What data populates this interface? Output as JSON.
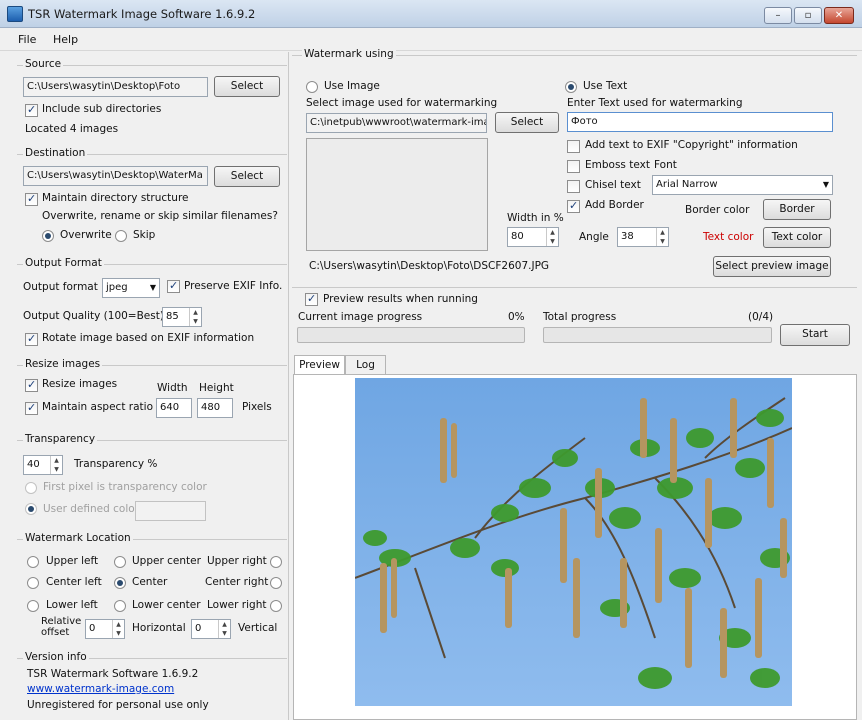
{
  "window": {
    "title": "TSR Watermark Image Software 1.6.9.2",
    "min": "–",
    "max": "▫",
    "close": "✕"
  },
  "menu": {
    "file": "File",
    "help": "Help"
  },
  "source": {
    "title": "Source",
    "path": "C:\\Users\\wasytin\\Desktop\\Foto",
    "select": "Select",
    "include_sub": "Include sub directories",
    "located": "Located 4 images"
  },
  "destination": {
    "title": "Destination",
    "path": "C:\\Users\\wasytin\\Desktop\\WaterMa",
    "select": "Select",
    "maintain": "Maintain directory structure",
    "question": "Overwrite, rename or skip similar filenames?",
    "overwrite": "Overwrite",
    "skip": "Skip"
  },
  "output": {
    "title": "Output Format",
    "format_label": "Output format",
    "format_value": "jpeg",
    "preserve_exif": "Preserve EXIF Info.",
    "quality_label": "Output Quality (100=Best)",
    "quality_value": "85",
    "rotate": "Rotate image based on EXIF information"
  },
  "resize": {
    "title": "Resize images",
    "resize_label": "Resize images",
    "width_header": "Width",
    "height_header": "Height",
    "aspect": "Maintain aspect ratio",
    "width": "640",
    "height": "480",
    "unit": "Pixels"
  },
  "transparency": {
    "title": "Transparency",
    "value": "40",
    "label": "Transparency %",
    "first_pixel": "First pixel is transparency color",
    "user_defined": "User defined color"
  },
  "location": {
    "title": "Watermark Location",
    "upper_left": "Upper left",
    "upper_center": "Upper center",
    "upper_right": "Upper right",
    "center_left": "Center left",
    "center": "Center",
    "center_right": "Center right",
    "lower_left": "Lower left",
    "lower_center": "Lower center",
    "lower_right": "Lower right",
    "relative_1": "Relative",
    "relative_2": "offset",
    "h_value": "0",
    "horizontal": "Horizontal",
    "v_value": "0",
    "vertical": "Vertical"
  },
  "version": {
    "title": "Version info",
    "line1": "TSR Watermark Software 1.6.9.2",
    "link": "www.watermark-image.com",
    "line3": "Unregistered for personal use only"
  },
  "watermark": {
    "title": "Watermark using",
    "use_image": "Use Image",
    "select_image_label": "Select image used for watermarking",
    "image_path": "C:\\inetpub\\wwwroot\\watermark-ima",
    "select": "Select",
    "width_label": "Width in %",
    "width_value": "80",
    "use_text": "Use Text",
    "enter_text_label": "Enter Text used for watermarking",
    "text_value": "Фото",
    "add_exif": "Add text to EXIF \"Copyright\" information",
    "emboss": "Emboss text",
    "chisel": "Chisel text",
    "add_border": "Add Border",
    "font_label": "Font",
    "font_value": "Arial Narrow",
    "border_color_label": "Border color",
    "border_btn": "Border",
    "angle_label": "Angle",
    "angle_value": "38",
    "text_color_label": "Text color",
    "text_color_btn": "Text color",
    "preview_path": "C:\\Users\\wasytin\\Desktop\\Foto\\DSCF2607.JPG",
    "select_preview": "Select preview image"
  },
  "progress": {
    "preview_when_running": "Preview results when running",
    "current_label": "Current image progress",
    "current_pct": "0%",
    "total_label": "Total progress",
    "total_count": "(0/4)",
    "start": "Start"
  },
  "tabs": {
    "preview": "Preview",
    "log": "Log"
  },
  "colors": {
    "accent": "#1d5fae",
    "text_color_label": "#cc0000",
    "link": "#0033cc",
    "sky": "#7aaee6"
  }
}
